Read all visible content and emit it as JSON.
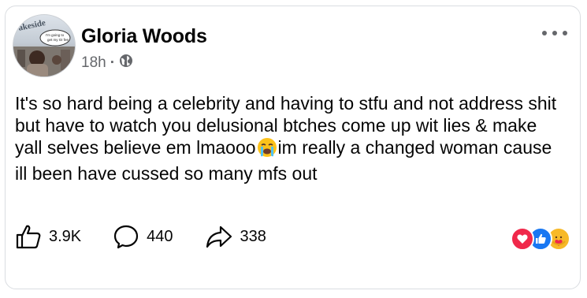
{
  "post": {
    "author": {
      "name": "Gloria Woods",
      "avatar_sign_text": "akeside",
      "avatar_bubble_text": "I'm going to get my GI fee"
    },
    "timestamp": "18h",
    "separator": "·",
    "audience_icon": "globe-icon",
    "more_icon": "more-dots-icon",
    "text_part1": "It's so hard being a celebrity and having to stfu and not address shit but have to watch you delusional btches come up wit lies & make yall selves believe em lmaooo",
    "inline_emoji": "loudly-crying-face",
    "text_part2": "im really a changed woman cause ill been have cussed so many mfs out"
  },
  "actions": {
    "like_count": "3.9K",
    "comment_count": "440",
    "share_count": "338"
  },
  "reactions": {
    "icons": [
      "love-reaction-icon",
      "like-reaction-icon",
      "care-reaction-icon"
    ],
    "colors": {
      "love": "#f0284a",
      "like": "#1877f2",
      "care": "#f7b928"
    }
  },
  "colors": {
    "text": "#050505",
    "secondary": "#65676b",
    "border": "#dadde1"
  }
}
